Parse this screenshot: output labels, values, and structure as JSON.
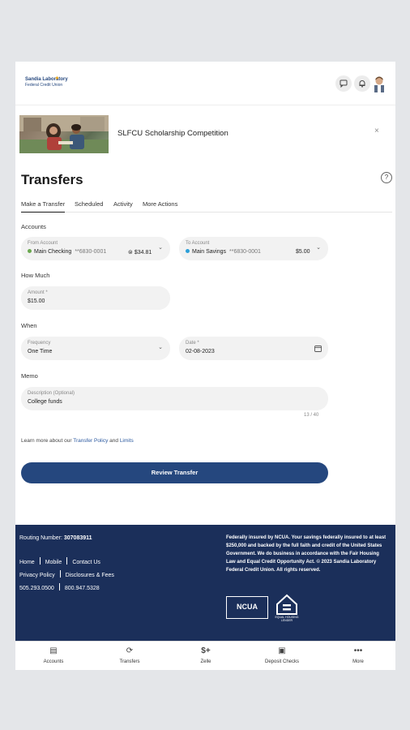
{
  "header": {
    "logo_line1": "Sandia Laboratory",
    "logo_line2": "Federal Credit Union",
    "chat_icon": "chat-icon",
    "bell_icon": "bell-icon"
  },
  "banner": {
    "title": "SLFCU Scholarship Competition",
    "close": "×"
  },
  "page": {
    "title": "Transfers",
    "help": "?"
  },
  "tabs": [
    {
      "label": "Make a Transfer"
    },
    {
      "label": "Scheduled"
    },
    {
      "label": "Activity"
    },
    {
      "label": "More Actions"
    }
  ],
  "form": {
    "accounts_label": "Accounts",
    "from": {
      "label": "From Account",
      "name": "Main Checking",
      "number": "**6830-0001",
      "balance": "$34.81",
      "dot_color": "#6aa84f"
    },
    "to": {
      "label": "To Account",
      "name": "Main Savings",
      "number": "**6830-0001",
      "balance": "$5.00",
      "dot_color": "#2b9fd8"
    },
    "how_much_label": "How Much",
    "amount": {
      "label": "Amount *",
      "value": "$15.00"
    },
    "when_label": "When",
    "frequency": {
      "label": "Frequency",
      "value": "One Time"
    },
    "date": {
      "label": "Date *",
      "value": "02-08-2023"
    },
    "memo_label": "Memo",
    "description": {
      "label": "Description (Optional)",
      "value": "College funds"
    },
    "counter": "13 / 40",
    "learn_prefix": "Learn more about our",
    "learn_link1": "Transfer Policy",
    "learn_and": "and",
    "learn_link2": "Limits",
    "review_button": "Review Transfer"
  },
  "footer": {
    "routing_label": "Routing Number:",
    "routing_number": "307083911",
    "links_row1": [
      "Home",
      "Mobile",
      "Contact Us"
    ],
    "links_row2": [
      "Privacy Policy",
      "Disclosures & Fees"
    ],
    "links_row3": [
      "505.293.0500",
      "800.947.5328"
    ],
    "disclaimer": "Federally insured by NCUA. Your savings federally insured to at least $250,000 and backed by the full faith and credit of the United States Government. We do business in accordance with the Fair Housing Law and Equal Credit Opportunity Act. © 2023 Sandia Laboratory Federal Credit Union. All rights reserved.",
    "ncua_badge": "NCUA",
    "ehl_label": "EQUAL HOUSING LENDER"
  },
  "nav": [
    {
      "label": "Accounts",
      "icon": "accounts-icon"
    },
    {
      "label": "Transfers",
      "icon": "transfers-icon"
    },
    {
      "label": "Zelle",
      "icon": "zelle-icon"
    },
    {
      "label": "Deposit Checks",
      "icon": "deposit-checks-icon"
    },
    {
      "label": "More",
      "icon": "more-icon"
    }
  ]
}
